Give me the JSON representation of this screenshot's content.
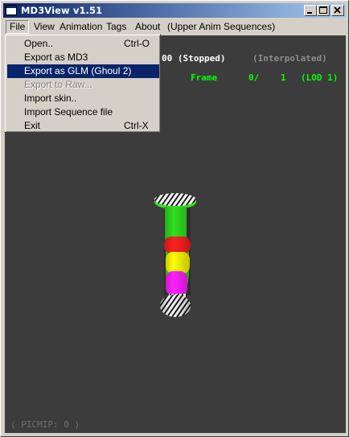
{
  "window": {
    "title": "MD3View v1.51",
    "controls": [
      "minimize",
      "maximize",
      "close"
    ]
  },
  "menubar": {
    "items": [
      {
        "label": "File"
      },
      {
        "label": "View"
      },
      {
        "label": "Animation"
      },
      {
        "label": "Tags"
      },
      {
        "label": "About"
      },
      {
        "label": "(Upper Anim Sequences)"
      }
    ]
  },
  "file_menu": {
    "items": [
      {
        "label": "Open..",
        "shortcut": "Ctrl-O",
        "state": "normal"
      },
      {
        "label": "Export as MD3",
        "shortcut": "",
        "state": "normal"
      },
      {
        "label": "Export as GLM (Ghoul 2)",
        "shortcut": "",
        "state": "highlighted"
      },
      {
        "label": "Export to Raw...",
        "shortcut": "",
        "state": "disabled"
      },
      {
        "label": "Import skin..",
        "shortcut": "",
        "state": "normal"
      },
      {
        "label": "Import Sequence file",
        "shortcut": "",
        "state": "normal"
      },
      {
        "label": "Exit",
        "shortcut": "Ctrl-X",
        "state": "normal"
      }
    ]
  },
  "viewport": {
    "background": "#3c3c3c",
    "status_stopped": "00 (Stopped)",
    "status_interpolated": "(Interpolated)",
    "frame_label": "Frame",
    "frame_value": "0/",
    "frame_total": "1",
    "lod": "(LOD 1)",
    "picmip": "( PICMIP: 0 )",
    "colors": {
      "stopped": "#ffffff",
      "interpolated": "#8c8c8c",
      "frame": "#00ff00",
      "picmip": "#6e6e6e"
    }
  },
  "model": {
    "segment_colors": [
      "#30e020",
      "#ff2020",
      "#ffff00",
      "#ff20ff"
    ]
  }
}
